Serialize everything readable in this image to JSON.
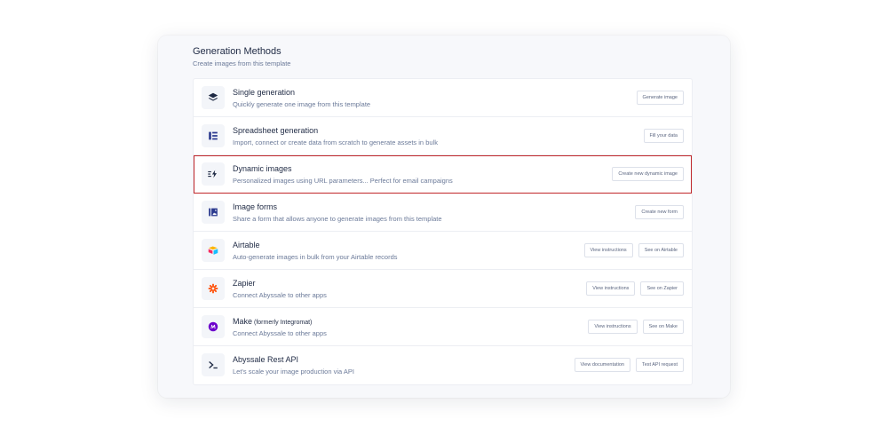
{
  "section": {
    "title": "Generation Methods",
    "subtitle": "Create images from this template"
  },
  "methods": [
    {
      "title": "Single generation",
      "desc": "Quickly generate one image from this template",
      "icon": "layers-icon",
      "buttons": [
        "Generate image"
      ]
    },
    {
      "title": "Spreadsheet generation",
      "desc": "Import, connect or create data from scratch to generate assets in bulk",
      "icon": "spreadsheet-icon",
      "buttons": [
        "Fill your data"
      ]
    },
    {
      "title": "Dynamic images",
      "desc": "Personalized images using URL parameters... Perfect for email campaigns",
      "icon": "lightning-icon",
      "buttons": [
        "Create new dynamic image"
      ]
    },
    {
      "title": "Image forms",
      "desc": "Share a form that allows anyone to generate images from this template",
      "icon": "form-image-icon",
      "buttons": [
        "Create new form"
      ]
    },
    {
      "title": "Airtable",
      "desc": "Auto-generate images in bulk from your Airtable records",
      "icon": "airtable-icon",
      "buttons": [
        "View instructions",
        "See on Airtable"
      ]
    },
    {
      "title": "Zapier",
      "desc": "Connect Abyssale to other apps",
      "icon": "zapier-icon",
      "buttons": [
        "View instructions",
        "See on Zapier"
      ]
    },
    {
      "title": "Make",
      "title_suffix": "(formerly Integromat)",
      "desc": "Connect Abyssale to other apps",
      "icon": "make-icon",
      "buttons": [
        "View instructions",
        "See on Make"
      ]
    },
    {
      "title": "Abyssale Rest API",
      "desc": "Let's scale your image production via API",
      "icon": "terminal-icon",
      "buttons": [
        "View documentation",
        "Test API request"
      ]
    }
  ],
  "highlight_color": "#c0262a"
}
